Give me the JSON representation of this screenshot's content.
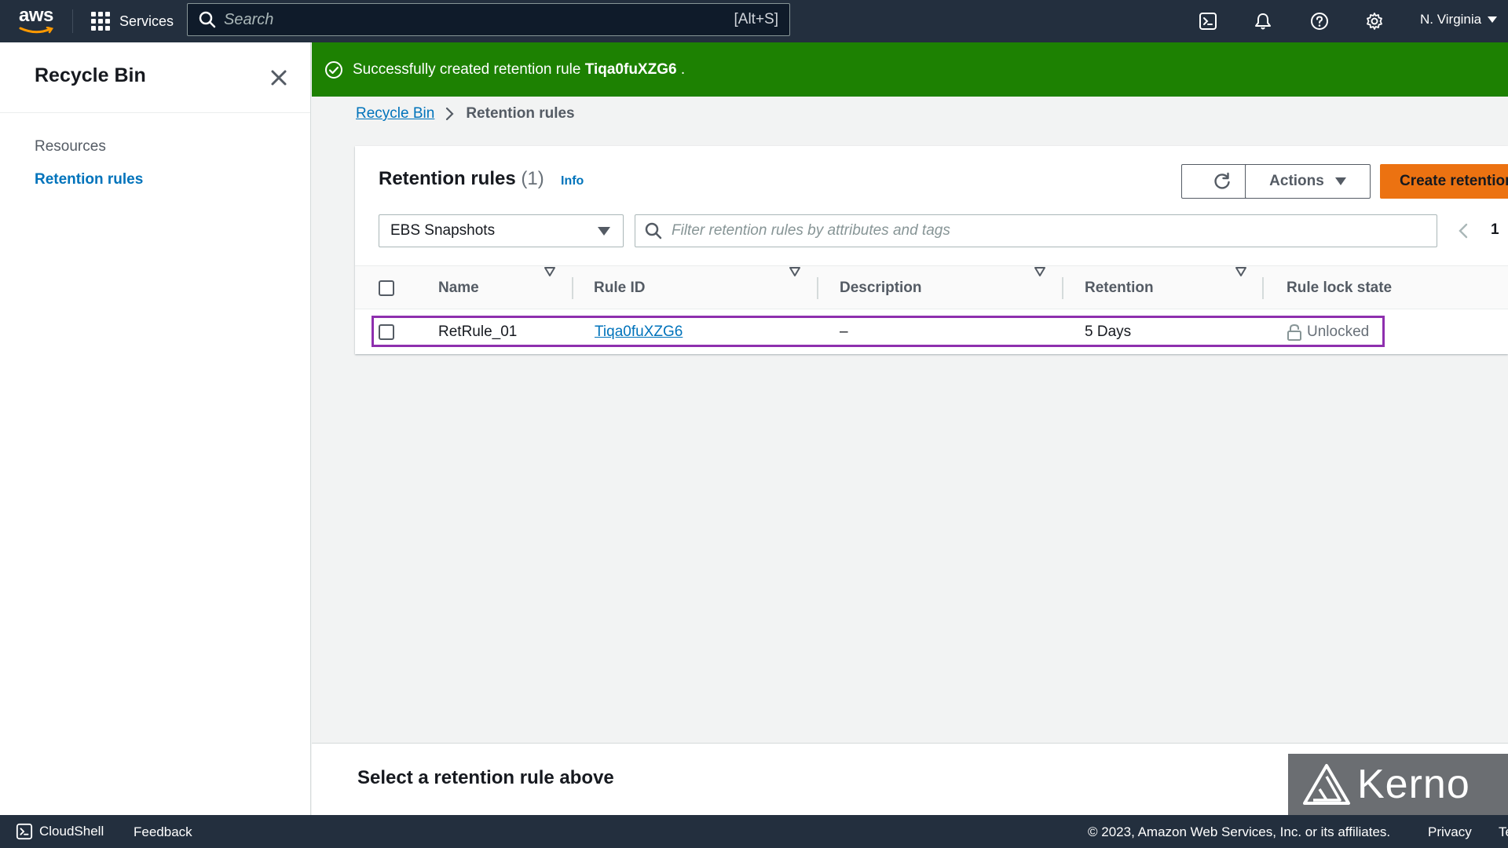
{
  "topnav": {
    "logo_text": "aws",
    "services_label": "Services",
    "search_placeholder": "Search",
    "search_shortcut": "[Alt+S]",
    "region_label": "N. Virginia"
  },
  "sidenav": {
    "title": "Recycle Bin",
    "items": [
      {
        "label": "Resources"
      },
      {
        "label": "Retention rules"
      }
    ]
  },
  "flash": {
    "prefix": "Successfully created retention rule ",
    "rule_id": "Tiqa0fuXZG6",
    "suffix": " .",
    "color": "#1d8102"
  },
  "breadcrumb": {
    "parent": "Recycle Bin",
    "current": "Retention rules"
  },
  "panel": {
    "title": "Retention rules",
    "count": "(1)",
    "info_label": "Info",
    "actions_label": "Actions",
    "create_label": "Create retention rule",
    "resource_select_value": "EBS Snapshots",
    "filter_placeholder": "Filter retention rules by attributes and tags",
    "page_number": "1",
    "columns": [
      "Name",
      "Rule ID",
      "Description",
      "Retention",
      "Rule lock state"
    ],
    "rows": [
      {
        "name": "RetRule_01",
        "rule_id": "Tiqa0fuXZG6",
        "description": "–",
        "retention": "5 Days",
        "lock_state": "Unlocked"
      }
    ]
  },
  "split": {
    "title": "Select a retention rule above"
  },
  "watermark": {
    "text": "Kerno"
  },
  "footer": {
    "cloudshell": "CloudShell",
    "feedback": "Feedback",
    "copyright": "© 2023, Amazon Web Services, Inc. or its affiliates.",
    "privacy": "Privacy",
    "terms": "Terms"
  },
  "colors": {
    "nav_bg": "#232f3e",
    "link": "#0073bb",
    "primary_button": "#ec7211",
    "highlight_outline": "#8e2fae"
  }
}
